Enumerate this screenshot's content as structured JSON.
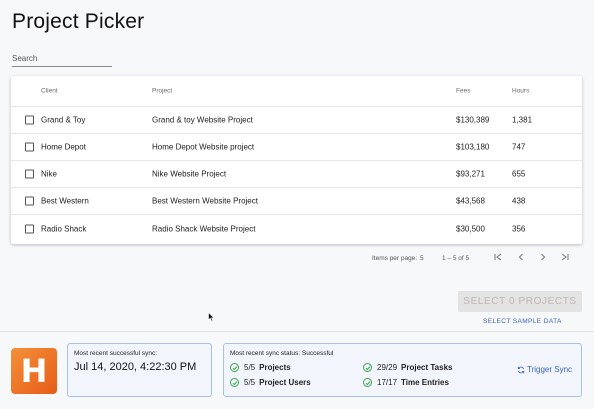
{
  "page": {
    "title": "Project Picker"
  },
  "search": {
    "placeholder": "Search"
  },
  "table": {
    "columns": {
      "client": "Client",
      "project": "Project",
      "fees": "Fees",
      "hours": "Hours"
    },
    "rows": [
      {
        "client": "Grand & Toy",
        "project": "Grand & toy Website Project",
        "fees": "$130,389",
        "hours": "1,381"
      },
      {
        "client": "Home Depot",
        "project": "Home Depot Website project",
        "fees": "$103,180",
        "hours": "747"
      },
      {
        "client": "Nike",
        "project": "Nike Website Project",
        "fees": "$93,271",
        "hours": "655"
      },
      {
        "client": "Best Western",
        "project": "Best Western Website Project",
        "fees": "$43,568",
        "hours": "438"
      },
      {
        "client": "Radio Shack",
        "project": "Radio Shack Website Project",
        "fees": "$30,500",
        "hours": "356"
      }
    ]
  },
  "pager": {
    "items_per_page_label": "Items per page:",
    "items_per_page": "5",
    "range": "1 – 5 of 5"
  },
  "actions": {
    "select_projects": "SELECT 0 PROJECTS",
    "select_sample_data": "SELECT SAMPLE DATA"
  },
  "footer": {
    "logo_letter": "H",
    "last_sync_label": "Most recent successful sync:",
    "last_sync_value": "Jul 14, 2020, 4:22:30 PM",
    "status_label": "Most recent sync status: Successful",
    "stats": [
      {
        "count": "5/5",
        "name": "Projects"
      },
      {
        "count": "5/5",
        "name": "Project Users"
      },
      {
        "count": "29/29",
        "name": "Project Tasks"
      },
      {
        "count": "17/17",
        "name": "Time Entries"
      }
    ],
    "trigger_label": "Trigger Sync"
  },
  "colors": {
    "accent": "#3a63b5",
    "success": "#3aa34c",
    "logo": "#ec7a2b",
    "status_border": "#a8c1e6"
  }
}
